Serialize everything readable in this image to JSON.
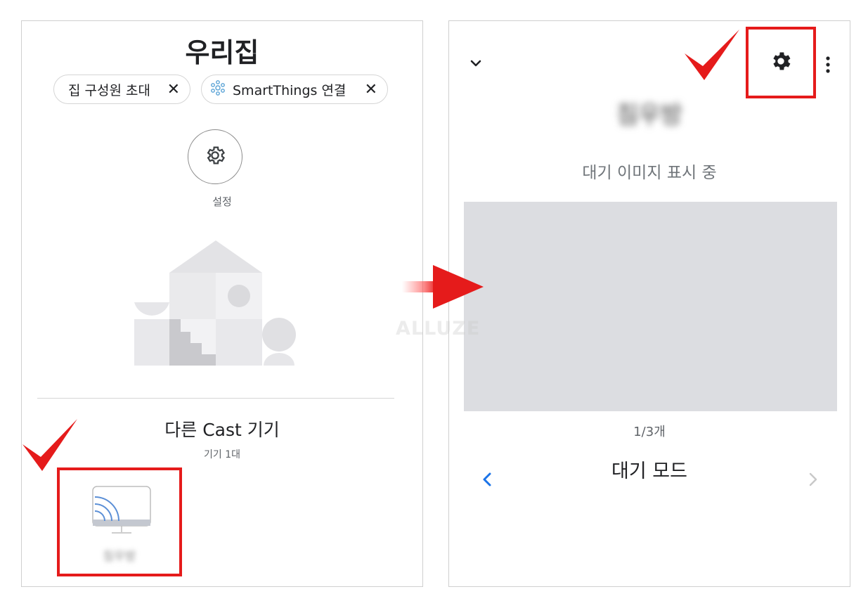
{
  "left": {
    "title": "우리집",
    "chips": [
      {
        "label": "집 구성원 초대",
        "close": "✕"
      },
      {
        "label": "SmartThings 연결",
        "close": "✕"
      }
    ],
    "settings_label": "설정",
    "cast_section_title": "다른 Cast 기기",
    "cast_count": "기기 1대",
    "device_name": "침우방"
  },
  "right": {
    "device_title": "침우방",
    "status": "대기 이미지 표시 중",
    "page_count": "1/3개",
    "mode_title": "대기 모드"
  },
  "watermark": "ALLUZE",
  "colors": {
    "highlight_red": "#e51b1b",
    "accent_blue": "#1a73e8",
    "preview_gray": "#dcdde1"
  },
  "icons": [
    "close-icon",
    "smartthings-icon",
    "settings-gear-icon",
    "cast-device-icon",
    "chevron-down-icon",
    "gear-icon",
    "more-vert-icon",
    "chevron-left-icon",
    "chevron-right-icon"
  ]
}
